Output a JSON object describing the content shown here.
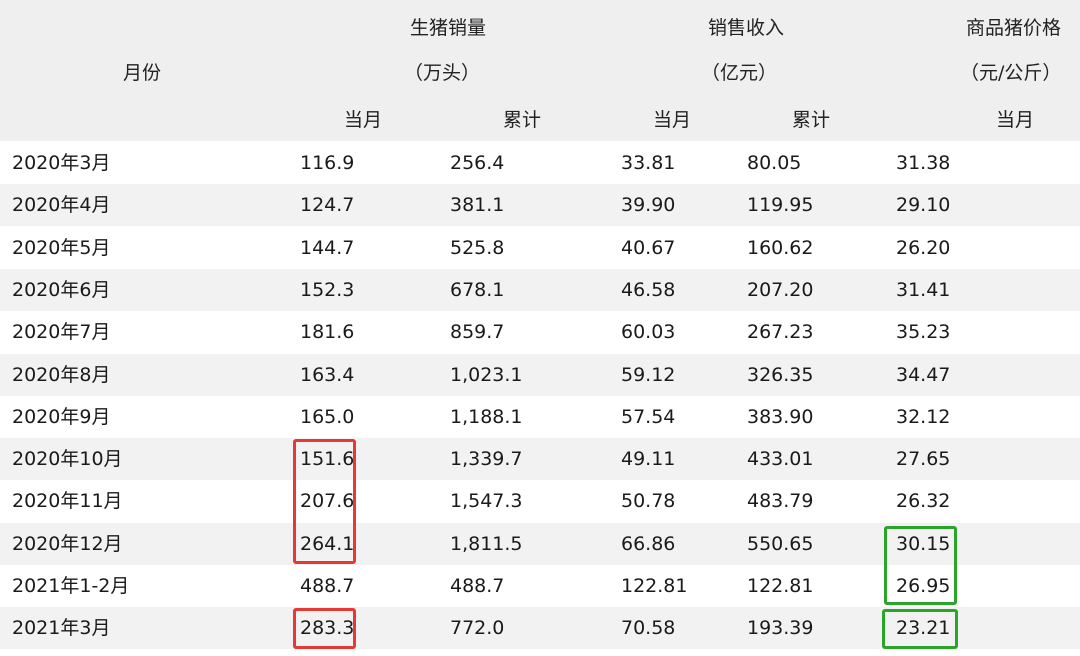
{
  "table": {
    "header": {
      "month": "月份",
      "sales_volume": {
        "title": "生猪销量",
        "unit": "（万头）",
        "current": "当月",
        "cumulative": "累计"
      },
      "revenue": {
        "title": "销售收入",
        "unit": "（亿元）",
        "current": "当月",
        "cumulative": "累计"
      },
      "price": {
        "title": "商品猪价格",
        "unit": "（元/公斤）",
        "current": "当月"
      }
    },
    "rows": [
      {
        "month": "2020年3月",
        "sales_current": "116.9",
        "sales_cumulative": "256.4",
        "revenue_current": "33.81",
        "revenue_cumulative": "80.05",
        "price_current": "31.38"
      },
      {
        "month": "2020年4月",
        "sales_current": "124.7",
        "sales_cumulative": "381.1",
        "revenue_current": "39.90",
        "revenue_cumulative": "119.95",
        "price_current": "29.10"
      },
      {
        "month": "2020年5月",
        "sales_current": "144.7",
        "sales_cumulative": "525.8",
        "revenue_current": "40.67",
        "revenue_cumulative": "160.62",
        "price_current": "26.20"
      },
      {
        "month": "2020年6月",
        "sales_current": "152.3",
        "sales_cumulative": "678.1",
        "revenue_current": "46.58",
        "revenue_cumulative": "207.20",
        "price_current": "31.41"
      },
      {
        "month": "2020年7月",
        "sales_current": "181.6",
        "sales_cumulative": "859.7",
        "revenue_current": "60.03",
        "revenue_cumulative": "267.23",
        "price_current": "35.23"
      },
      {
        "month": "2020年8月",
        "sales_current": "163.4",
        "sales_cumulative": "1,023.1",
        "revenue_current": "59.12",
        "revenue_cumulative": "326.35",
        "price_current": "34.47"
      },
      {
        "month": "2020年9月",
        "sales_current": "165.0",
        "sales_cumulative": "1,188.1",
        "revenue_current": "57.54",
        "revenue_cumulative": "383.90",
        "price_current": "32.12"
      },
      {
        "month": "2020年10月",
        "sales_current": "151.6",
        "sales_cumulative": "1,339.7",
        "revenue_current": "49.11",
        "revenue_cumulative": "433.01",
        "price_current": "27.65"
      },
      {
        "month": "2020年11月",
        "sales_current": "207.6",
        "sales_cumulative": "1,547.3",
        "revenue_current": "50.78",
        "revenue_cumulative": "483.79",
        "price_current": "26.32"
      },
      {
        "month": "2020年12月",
        "sales_current": "264.1",
        "sales_cumulative": "1,811.5",
        "revenue_current": "66.86",
        "revenue_cumulative": "550.65",
        "price_current": "30.15"
      },
      {
        "month": "2021年1-2月",
        "sales_current": "488.7",
        "sales_cumulative": "488.7",
        "revenue_current": "122.81",
        "revenue_cumulative": "122.81",
        "price_current": "26.95"
      },
      {
        "month": "2021年3月",
        "sales_current": "283.3",
        "sales_cumulative": "772.0",
        "revenue_current": "70.58",
        "revenue_cumulative": "193.39",
        "price_current": "23.21"
      }
    ]
  },
  "highlights": {
    "red_color": "#e53935",
    "green_color": "#2aa52a"
  }
}
